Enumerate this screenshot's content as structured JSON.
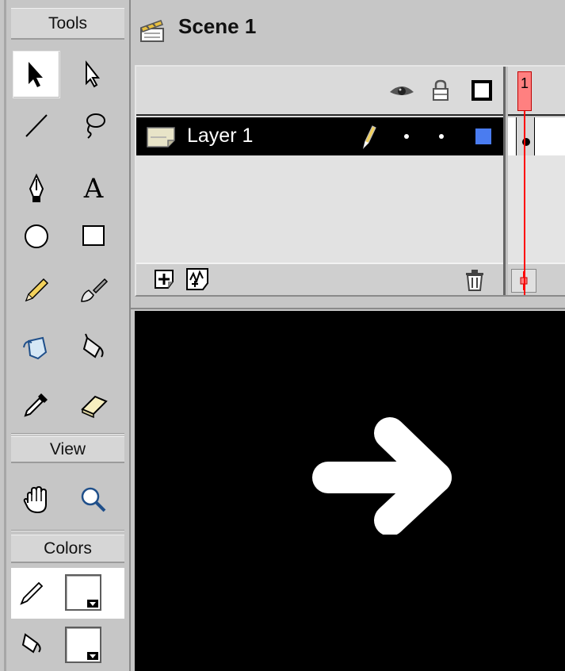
{
  "tools_panel": {
    "header": "Tools",
    "tools": [
      {
        "name": "arrow-tool",
        "selected": true
      },
      {
        "name": "subselect-tool"
      },
      {
        "name": "line-tool"
      },
      {
        "name": "lasso-tool"
      },
      {
        "name": "pen-tool"
      },
      {
        "name": "text-tool",
        "glyph": "A"
      },
      {
        "name": "oval-tool"
      },
      {
        "name": "rectangle-tool"
      },
      {
        "name": "pencil-tool"
      },
      {
        "name": "brush-tool"
      },
      {
        "name": "ink-bottle-tool"
      },
      {
        "name": "paint-bucket-tool"
      },
      {
        "name": "eyedropper-tool"
      },
      {
        "name": "eraser-tool"
      }
    ],
    "view_header": "View",
    "view_tools": [
      {
        "name": "hand-tool"
      },
      {
        "name": "zoom-tool"
      }
    ],
    "colors_header": "Colors",
    "stroke_color": "#ffffff",
    "fill_color": "#ffffff"
  },
  "scene": {
    "title": "Scene 1"
  },
  "timeline": {
    "layer_name": "Layer 1",
    "current_frame": "1",
    "layer_outline_color": "#4a7cf0",
    "playhead_color": "#ff0000"
  },
  "stage": {
    "background_color": "#000000",
    "shape_color": "#ffffff",
    "shape": "right-arrow"
  }
}
